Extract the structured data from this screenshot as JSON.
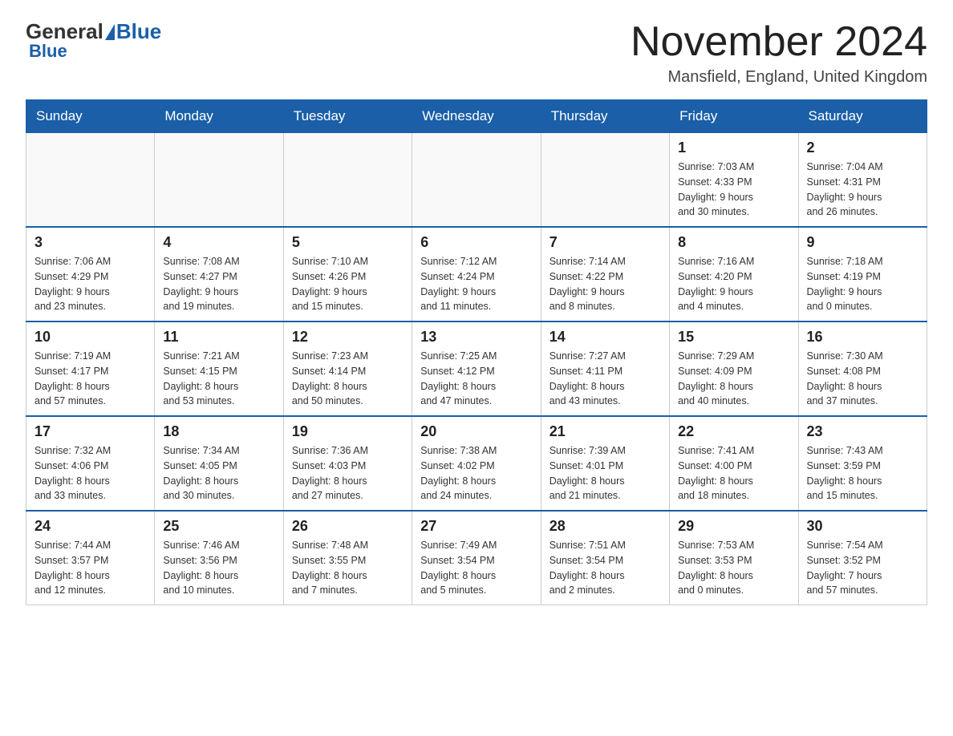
{
  "logo": {
    "general": "General",
    "blue": "Blue"
  },
  "title": "November 2024",
  "subtitle": "Mansfield, England, United Kingdom",
  "days_of_week": [
    "Sunday",
    "Monday",
    "Tuesday",
    "Wednesday",
    "Thursday",
    "Friday",
    "Saturday"
  ],
  "weeks": [
    [
      {
        "day": "",
        "info": ""
      },
      {
        "day": "",
        "info": ""
      },
      {
        "day": "",
        "info": ""
      },
      {
        "day": "",
        "info": ""
      },
      {
        "day": "",
        "info": ""
      },
      {
        "day": "1",
        "info": "Sunrise: 7:03 AM\nSunset: 4:33 PM\nDaylight: 9 hours\nand 30 minutes."
      },
      {
        "day": "2",
        "info": "Sunrise: 7:04 AM\nSunset: 4:31 PM\nDaylight: 9 hours\nand 26 minutes."
      }
    ],
    [
      {
        "day": "3",
        "info": "Sunrise: 7:06 AM\nSunset: 4:29 PM\nDaylight: 9 hours\nand 23 minutes."
      },
      {
        "day": "4",
        "info": "Sunrise: 7:08 AM\nSunset: 4:27 PM\nDaylight: 9 hours\nand 19 minutes."
      },
      {
        "day": "5",
        "info": "Sunrise: 7:10 AM\nSunset: 4:26 PM\nDaylight: 9 hours\nand 15 minutes."
      },
      {
        "day": "6",
        "info": "Sunrise: 7:12 AM\nSunset: 4:24 PM\nDaylight: 9 hours\nand 11 minutes."
      },
      {
        "day": "7",
        "info": "Sunrise: 7:14 AM\nSunset: 4:22 PM\nDaylight: 9 hours\nand 8 minutes."
      },
      {
        "day": "8",
        "info": "Sunrise: 7:16 AM\nSunset: 4:20 PM\nDaylight: 9 hours\nand 4 minutes."
      },
      {
        "day": "9",
        "info": "Sunrise: 7:18 AM\nSunset: 4:19 PM\nDaylight: 9 hours\nand 0 minutes."
      }
    ],
    [
      {
        "day": "10",
        "info": "Sunrise: 7:19 AM\nSunset: 4:17 PM\nDaylight: 8 hours\nand 57 minutes."
      },
      {
        "day": "11",
        "info": "Sunrise: 7:21 AM\nSunset: 4:15 PM\nDaylight: 8 hours\nand 53 minutes."
      },
      {
        "day": "12",
        "info": "Sunrise: 7:23 AM\nSunset: 4:14 PM\nDaylight: 8 hours\nand 50 minutes."
      },
      {
        "day": "13",
        "info": "Sunrise: 7:25 AM\nSunset: 4:12 PM\nDaylight: 8 hours\nand 47 minutes."
      },
      {
        "day": "14",
        "info": "Sunrise: 7:27 AM\nSunset: 4:11 PM\nDaylight: 8 hours\nand 43 minutes."
      },
      {
        "day": "15",
        "info": "Sunrise: 7:29 AM\nSunset: 4:09 PM\nDaylight: 8 hours\nand 40 minutes."
      },
      {
        "day": "16",
        "info": "Sunrise: 7:30 AM\nSunset: 4:08 PM\nDaylight: 8 hours\nand 37 minutes."
      }
    ],
    [
      {
        "day": "17",
        "info": "Sunrise: 7:32 AM\nSunset: 4:06 PM\nDaylight: 8 hours\nand 33 minutes."
      },
      {
        "day": "18",
        "info": "Sunrise: 7:34 AM\nSunset: 4:05 PM\nDaylight: 8 hours\nand 30 minutes."
      },
      {
        "day": "19",
        "info": "Sunrise: 7:36 AM\nSunset: 4:03 PM\nDaylight: 8 hours\nand 27 minutes."
      },
      {
        "day": "20",
        "info": "Sunrise: 7:38 AM\nSunset: 4:02 PM\nDaylight: 8 hours\nand 24 minutes."
      },
      {
        "day": "21",
        "info": "Sunrise: 7:39 AM\nSunset: 4:01 PM\nDaylight: 8 hours\nand 21 minutes."
      },
      {
        "day": "22",
        "info": "Sunrise: 7:41 AM\nSunset: 4:00 PM\nDaylight: 8 hours\nand 18 minutes."
      },
      {
        "day": "23",
        "info": "Sunrise: 7:43 AM\nSunset: 3:59 PM\nDaylight: 8 hours\nand 15 minutes."
      }
    ],
    [
      {
        "day": "24",
        "info": "Sunrise: 7:44 AM\nSunset: 3:57 PM\nDaylight: 8 hours\nand 12 minutes."
      },
      {
        "day": "25",
        "info": "Sunrise: 7:46 AM\nSunset: 3:56 PM\nDaylight: 8 hours\nand 10 minutes."
      },
      {
        "day": "26",
        "info": "Sunrise: 7:48 AM\nSunset: 3:55 PM\nDaylight: 8 hours\nand 7 minutes."
      },
      {
        "day": "27",
        "info": "Sunrise: 7:49 AM\nSunset: 3:54 PM\nDaylight: 8 hours\nand 5 minutes."
      },
      {
        "day": "28",
        "info": "Sunrise: 7:51 AM\nSunset: 3:54 PM\nDaylight: 8 hours\nand 2 minutes."
      },
      {
        "day": "29",
        "info": "Sunrise: 7:53 AM\nSunset: 3:53 PM\nDaylight: 8 hours\nand 0 minutes."
      },
      {
        "day": "30",
        "info": "Sunrise: 7:54 AM\nSunset: 3:52 PM\nDaylight: 7 hours\nand 57 minutes."
      }
    ]
  ]
}
